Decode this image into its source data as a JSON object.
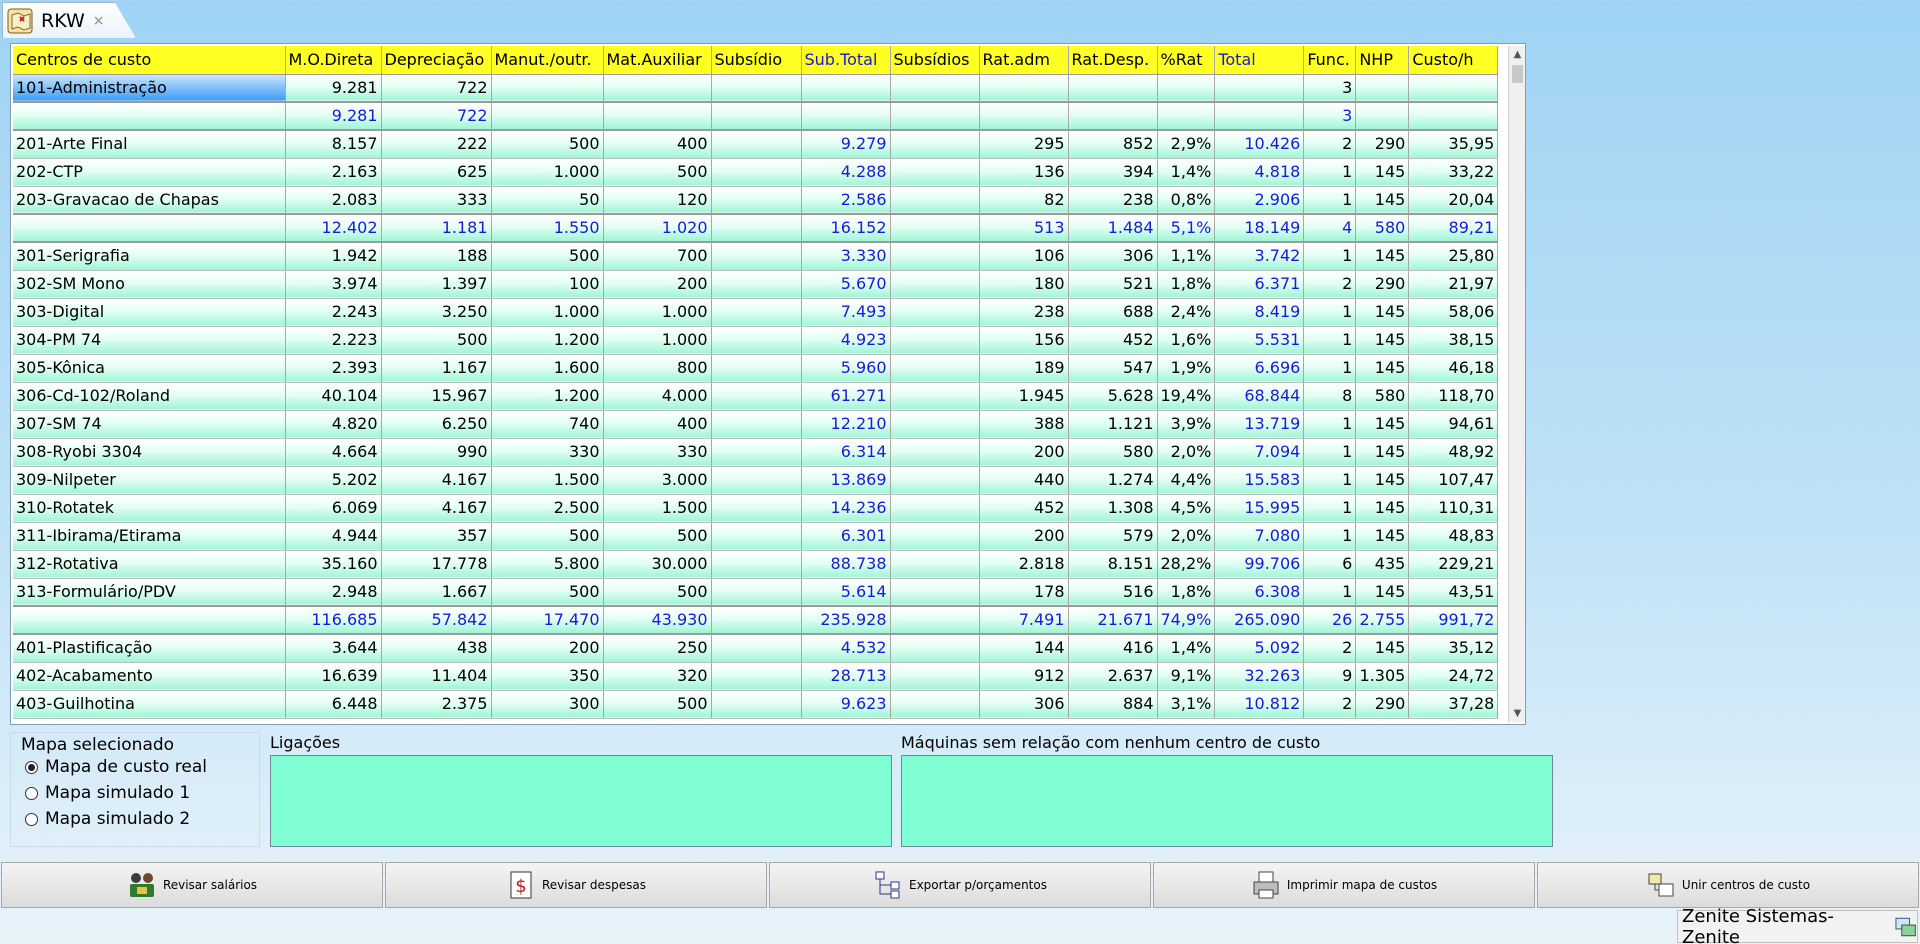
{
  "tab": {
    "title": "RKW",
    "close": "×"
  },
  "grid": {
    "columns": [
      {
        "label": "Centros de custo",
        "blue": false
      },
      {
        "label": "M.O.Direta",
        "blue": false
      },
      {
        "label": "Depreciação",
        "blue": false
      },
      {
        "label": "Manut./outr.",
        "blue": false
      },
      {
        "label": "Mat.Auxiliar",
        "blue": false
      },
      {
        "label": "Subsídio",
        "blue": false
      },
      {
        "label": "Sub.Total",
        "blue": true
      },
      {
        "label": "Subsídios",
        "blue": false
      },
      {
        "label": "Rat.adm",
        "blue": false
      },
      {
        "label": "Rat.Desp.",
        "blue": false
      },
      {
        "label": "%Rat",
        "blue": false
      },
      {
        "label": "Total",
        "blue": true
      },
      {
        "label": "Func.",
        "blue": false
      },
      {
        "label": "NHP",
        "blue": false
      },
      {
        "label": "Custo/h",
        "blue": false
      }
    ],
    "rows": [
      {
        "type": "data",
        "selected": true,
        "cells": [
          "101-Administração",
          "9.281",
          "722",
          "",
          "",
          "",
          "",
          "",
          "",
          "",
          "",
          "",
          "3",
          "",
          ""
        ]
      },
      {
        "type": "sub",
        "cells": [
          "",
          "9.281",
          "722",
          "",
          "",
          "",
          "",
          "",
          "",
          "",
          "",
          "",
          "3",
          "",
          ""
        ]
      },
      {
        "type": "data",
        "cells": [
          "201-Arte Final",
          "8.157",
          "222",
          "500",
          "400",
          "",
          "9.279",
          "",
          "295",
          "852",
          "2,9%",
          "10.426",
          "2",
          "290",
          "35,95"
        ]
      },
      {
        "type": "data",
        "cells": [
          "202-CTP",
          "2.163",
          "625",
          "1.000",
          "500",
          "",
          "4.288",
          "",
          "136",
          "394",
          "1,4%",
          "4.818",
          "1",
          "145",
          "33,22"
        ]
      },
      {
        "type": "data",
        "cells": [
          "203-Gravacao de Chapas",
          "2.083",
          "333",
          "50",
          "120",
          "",
          "2.586",
          "",
          "82",
          "238",
          "0,8%",
          "2.906",
          "1",
          "145",
          "20,04"
        ]
      },
      {
        "type": "sub",
        "cells": [
          "",
          "12.402",
          "1.181",
          "1.550",
          "1.020",
          "",
          "16.152",
          "",
          "513",
          "1.484",
          "5,1%",
          "18.149",
          "4",
          "580",
          "89,21"
        ]
      },
      {
        "type": "data",
        "cells": [
          "301-Serigrafia",
          "1.942",
          "188",
          "500",
          "700",
          "",
          "3.330",
          "",
          "106",
          "306",
          "1,1%",
          "3.742",
          "1",
          "145",
          "25,80"
        ]
      },
      {
        "type": "data",
        "cells": [
          "302-SM Mono",
          "3.974",
          "1.397",
          "100",
          "200",
          "",
          "5.670",
          "",
          "180",
          "521",
          "1,8%",
          "6.371",
          "2",
          "290",
          "21,97"
        ]
      },
      {
        "type": "data",
        "cells": [
          "303-Digital",
          "2.243",
          "3.250",
          "1.000",
          "1.000",
          "",
          "7.493",
          "",
          "238",
          "688",
          "2,4%",
          "8.419",
          "1",
          "145",
          "58,06"
        ]
      },
      {
        "type": "data",
        "cells": [
          "304-PM 74",
          "2.223",
          "500",
          "1.200",
          "1.000",
          "",
          "4.923",
          "",
          "156",
          "452",
          "1,6%",
          "5.531",
          "1",
          "145",
          "38,15"
        ]
      },
      {
        "type": "data",
        "cells": [
          "305-Kônica",
          "2.393",
          "1.167",
          "1.600",
          "800",
          "",
          "5.960",
          "",
          "189",
          "547",
          "1,9%",
          "6.696",
          "1",
          "145",
          "46,18"
        ]
      },
      {
        "type": "data",
        "cells": [
          "306-Cd-102/Roland",
          "40.104",
          "15.967",
          "1.200",
          "4.000",
          "",
          "61.271",
          "",
          "1.945",
          "5.628",
          "19,4%",
          "68.844",
          "8",
          "580",
          "118,70"
        ]
      },
      {
        "type": "data",
        "cells": [
          "307-SM 74",
          "4.820",
          "6.250",
          "740",
          "400",
          "",
          "12.210",
          "",
          "388",
          "1.121",
          "3,9%",
          "13.719",
          "1",
          "145",
          "94,61"
        ]
      },
      {
        "type": "data",
        "cells": [
          "308-Ryobi 3304",
          "4.664",
          "990",
          "330",
          "330",
          "",
          "6.314",
          "",
          "200",
          "580",
          "2,0%",
          "7.094",
          "1",
          "145",
          "48,92"
        ]
      },
      {
        "type": "data",
        "cells": [
          "309-Nilpeter",
          "5.202",
          "4.167",
          "1.500",
          "3.000",
          "",
          "13.869",
          "",
          "440",
          "1.274",
          "4,4%",
          "15.583",
          "1",
          "145",
          "107,47"
        ]
      },
      {
        "type": "data",
        "cells": [
          "310-Rotatek",
          "6.069",
          "4.167",
          "2.500",
          "1.500",
          "",
          "14.236",
          "",
          "452",
          "1.308",
          "4,5%",
          "15.995",
          "1",
          "145",
          "110,31"
        ]
      },
      {
        "type": "data",
        "cells": [
          "311-Ibirama/Etirama",
          "4.944",
          "357",
          "500",
          "500",
          "",
          "6.301",
          "",
          "200",
          "579",
          "2,0%",
          "7.080",
          "1",
          "145",
          "48,83"
        ]
      },
      {
        "type": "data",
        "cells": [
          "312-Rotativa",
          "35.160",
          "17.778",
          "5.800",
          "30.000",
          "",
          "88.738",
          "",
          "2.818",
          "8.151",
          "28,2%",
          "99.706",
          "6",
          "435",
          "229,21"
        ]
      },
      {
        "type": "data",
        "cells": [
          "313-Formulário/PDV",
          "2.948",
          "1.667",
          "500",
          "500",
          "",
          "5.614",
          "",
          "178",
          "516",
          "1,8%",
          "6.308",
          "1",
          "145",
          "43,51"
        ]
      },
      {
        "type": "sub",
        "cells": [
          "",
          "116.685",
          "57.842",
          "17.470",
          "43.930",
          "",
          "235.928",
          "",
          "7.491",
          "21.671",
          "74,9%",
          "265.090",
          "26",
          "2.755",
          "991,72"
        ]
      },
      {
        "type": "data",
        "cells": [
          "401-Plastificação",
          "3.644",
          "438",
          "200",
          "250",
          "",
          "4.532",
          "",
          "144",
          "416",
          "1,4%",
          "5.092",
          "2",
          "145",
          "35,12"
        ]
      },
      {
        "type": "data",
        "cells": [
          "402-Acabamento",
          "16.639",
          "11.404",
          "350",
          "320",
          "",
          "28.713",
          "",
          "912",
          "2.637",
          "9,1%",
          "32.263",
          "9",
          "1.305",
          "24,72"
        ]
      },
      {
        "type": "data",
        "cells": [
          "403-Guilhotina",
          "6.448",
          "2.375",
          "300",
          "500",
          "",
          "9.623",
          "",
          "306",
          "884",
          "3,1%",
          "10.812",
          "2",
          "290",
          "37,28"
        ]
      }
    ]
  },
  "mapa": {
    "title": "Mapa selecionado",
    "options": [
      {
        "label": "Mapa de custo real",
        "selected": true
      },
      {
        "label": "Mapa simulado 1",
        "selected": false
      },
      {
        "label": "Mapa simulado 2",
        "selected": false
      }
    ]
  },
  "ligacoes": {
    "title": "Ligações"
  },
  "maquinas": {
    "title": "Máquinas sem relação com nenhum centro de custo"
  },
  "buttons": {
    "revisar_salarios": "Revisar salários",
    "revisar_despesas": "Revisar despesas",
    "exportar": "Exportar p/orçamentos",
    "imprimir": "Imprimir mapa de custos",
    "unir": "Unir centros de custo"
  },
  "status": {
    "text": "Zenite Sistemas-Zenite"
  },
  "colors": {
    "header": "#ffff21",
    "blue_text": "#1a1ad6",
    "green_box": "#80ffd4"
  }
}
